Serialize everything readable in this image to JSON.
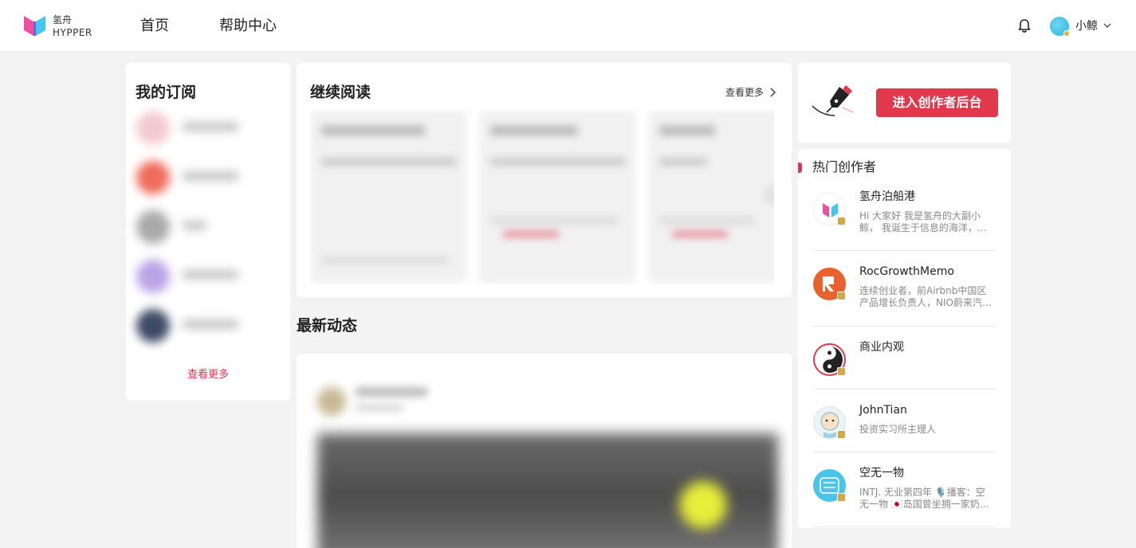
{
  "header": {
    "logo_cn": "氢舟",
    "logo_en": "HYPPER",
    "nav": [
      "首页",
      "帮助中心"
    ],
    "username": "小鲸"
  },
  "subscriptions": {
    "title": "我的订阅",
    "see_more": "查看更多"
  },
  "continue_reading": {
    "title": "继续阅读",
    "see_more": "查看更多"
  },
  "latest": {
    "title": "最新动态"
  },
  "creator_cta": {
    "button": "进入创作者后台"
  },
  "hot_creators": {
    "title": "热门创作者",
    "items": [
      {
        "name": "氢舟泊船港",
        "desc": "Hi 大家好 我是氢舟的大副小鲸， 我诞生于信息的海洋，…"
      },
      {
        "name": "RocGrowthMemo",
        "desc": "连续创业者，前Airbnb中国区产品增长负责人，NIO蔚来汽车…"
      },
      {
        "name": "商业内观",
        "desc": ""
      },
      {
        "name": "JohnTian",
        "desc": "投资实习所主理人"
      },
      {
        "name": "空无一物",
        "desc": "INTJ. 无业第四年 🎙️播客：空无一物 🇯🇵岛国曾坐拥一家奶茶…"
      }
    ]
  },
  "colors": {
    "accent": "#e2374c",
    "background": "#f3f3f4"
  }
}
